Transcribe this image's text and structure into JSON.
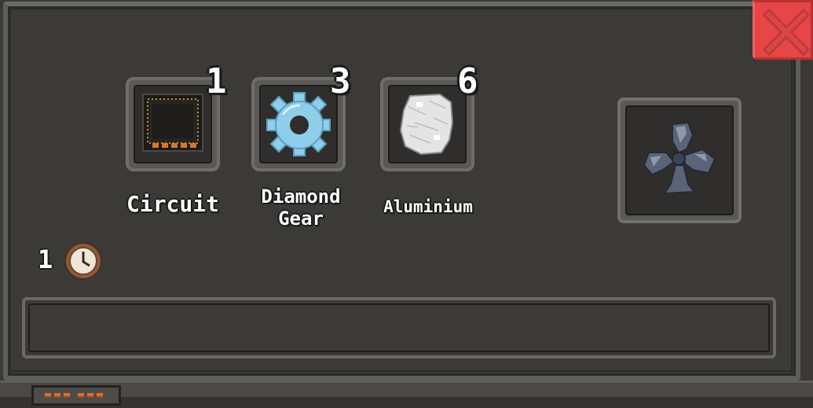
{
  "window": {
    "close_icon": "close-x-icon",
    "accent_close": "#e64646"
  },
  "ingredients": [
    {
      "name": "Circuit",
      "count": "1",
      "icon": "circuit-chip-icon"
    },
    {
      "name": "Diamond\nGear",
      "count": "3",
      "icon": "gear-icon"
    },
    {
      "name": "Aluminium",
      "count": "6",
      "icon": "aluminium-ore-icon"
    }
  ],
  "craft_time": {
    "value": "1",
    "icon": "clock-icon"
  },
  "output": {
    "icon": "fan-icon"
  },
  "progress": {
    "fraction": 0
  }
}
